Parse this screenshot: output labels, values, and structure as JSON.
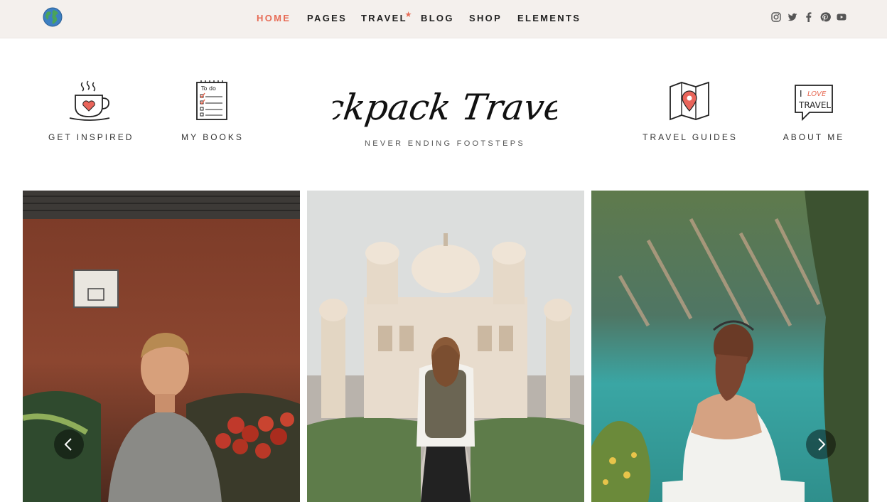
{
  "nav": {
    "items": [
      {
        "label": "HOME",
        "active": true
      },
      {
        "label": "PAGES"
      },
      {
        "label": "TRAVEL",
        "badge": "★"
      },
      {
        "label": "BLOG"
      },
      {
        "label": "SHOP"
      },
      {
        "label": "ELEMENTS"
      }
    ],
    "accent": "#e76b55"
  },
  "socials": [
    "instagram-icon",
    "twitter-icon",
    "facebook-icon",
    "pinterest-icon",
    "youtube-icon"
  ],
  "header": {
    "left": [
      {
        "label": "GET INSPIRED",
        "icon": "coffee-cup-heart-icon"
      },
      {
        "label": "MY BOOKS",
        "icon": "todo-notebook-icon"
      }
    ],
    "brand": {
      "name": "Backpack Traveler",
      "tagline": "NEVER ENDING FOOTSTEPS"
    },
    "right": [
      {
        "label": "TRAVEL GUIDES",
        "icon": "map-pin-icon"
      },
      {
        "label": "ABOUT ME",
        "icon": "i-love-travel-bubble-icon"
      }
    ],
    "todo_text": "To do",
    "bubble_text": {
      "line1": "I",
      "love": "LOVE",
      "line2": "TRAVEL"
    }
  },
  "slider": {
    "slides": [
      {
        "name": "market-man-photo"
      },
      {
        "name": "palace-woman-photo"
      },
      {
        "name": "lake-woman-photo"
      }
    ],
    "prev": "chevron-left-icon",
    "next": "chevron-right-icon"
  },
  "colors": {
    "topbar": "#f4f0ed",
    "accent": "#e76b55"
  }
}
